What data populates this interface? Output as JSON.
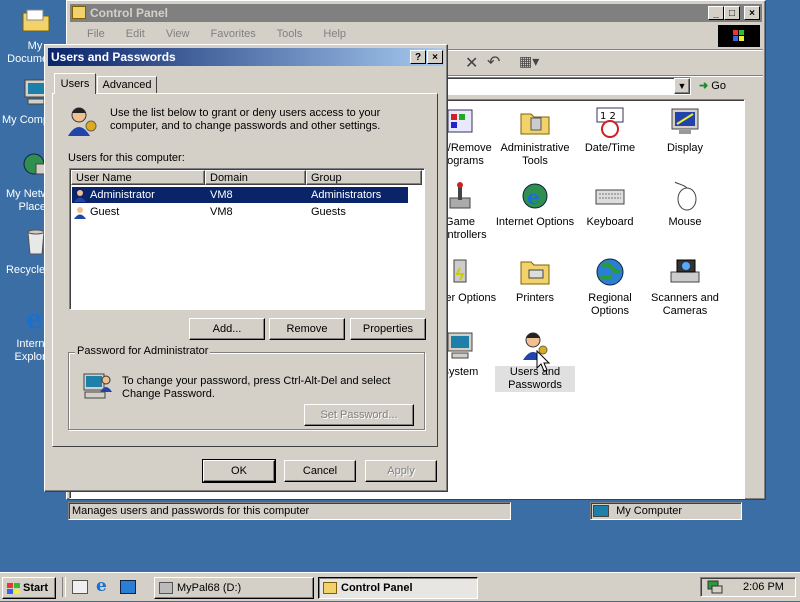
{
  "desktop": {
    "icons": [
      {
        "label": "My Documents",
        "icon": "folder-icon"
      },
      {
        "label": "My Computer",
        "icon": "computer-icon"
      },
      {
        "label": "My Network Places",
        "icon": "network-icon"
      },
      {
        "label": "Recycle Bin",
        "icon": "recycle-bin-icon"
      },
      {
        "label": "Internet Explorer",
        "icon": "ie-icon"
      }
    ]
  },
  "control_panel": {
    "title": "Control Panel",
    "menu": [
      "File",
      "Edit",
      "View",
      "Favorites",
      "Tools",
      "Help"
    ],
    "go_label": "Go",
    "status_text": "Manages users and passwords for this computer",
    "status_zone": "My Computer",
    "items": [
      {
        "label": "Add/Remove Programs",
        "icon": "add-remove-programs-icon"
      },
      {
        "label": "Administrative Tools",
        "icon": "administrative-tools-icon"
      },
      {
        "label": "Date/Time",
        "icon": "date-time-icon"
      },
      {
        "label": "Display",
        "icon": "display-icon"
      },
      {
        "label": "Game Controllers",
        "icon": "game-controllers-icon"
      },
      {
        "label": "Internet Options",
        "icon": "internet-options-icon"
      },
      {
        "label": "Keyboard",
        "icon": "keyboard-icon"
      },
      {
        "label": "Mouse",
        "icon": "mouse-icon"
      },
      {
        "label": "Power Options",
        "icon": "power-options-icon"
      },
      {
        "label": "Printers",
        "icon": "printers-icon"
      },
      {
        "label": "Regional Options",
        "icon": "regional-options-icon"
      },
      {
        "label": "Scanners and Cameras",
        "icon": "scanners-cameras-icon"
      },
      {
        "label": "System",
        "icon": "system-icon"
      },
      {
        "label": "Users and Passwords",
        "icon": "users-passwords-icon"
      }
    ]
  },
  "dialog": {
    "title": "Users and Passwords",
    "tabs": [
      "Users",
      "Advanced"
    ],
    "intro": "Use the list below to grant or deny users access to your computer, and to change passwords and other settings.",
    "list_label": "Users for this computer:",
    "columns": [
      "User Name",
      "Domain",
      "Group"
    ],
    "rows": [
      {
        "name": "Administrator",
        "domain": "VM8",
        "group": "Administrators",
        "selected": true
      },
      {
        "name": "Guest",
        "domain": "VM8",
        "group": "Guests",
        "selected": false
      }
    ],
    "buttons": {
      "add": "Add...",
      "remove": "Remove",
      "properties": "Properties"
    },
    "password_group": "Password for Administrator",
    "password_text": "To change your password, press Ctrl-Alt-Del and select Change Password.",
    "set_password": "Set Password...",
    "ok": "OK",
    "cancel": "Cancel",
    "apply": "Apply"
  },
  "taskbar": {
    "start": "Start",
    "tasks": [
      "MyPal68 (D:)",
      "Control Panel"
    ],
    "clock": "2:06 PM"
  },
  "colors": {
    "desktop": "#3a6ea5",
    "title_active": "#0a246a",
    "title_inactive": "#808080",
    "selection": "#0a246a"
  }
}
